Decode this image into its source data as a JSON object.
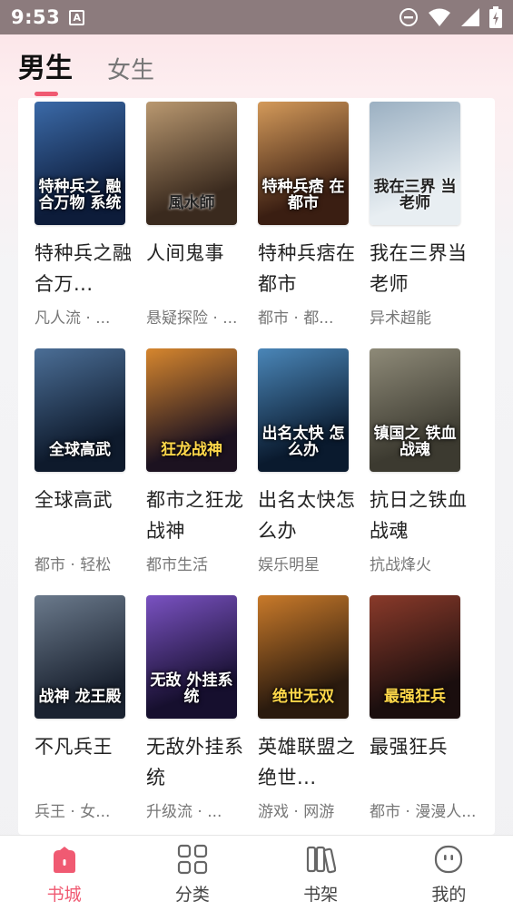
{
  "status_bar": {
    "time": "9:53",
    "notification": "A"
  },
  "tabs": [
    {
      "label": "男生",
      "active": true
    },
    {
      "label": "女生",
      "active": false
    }
  ],
  "books": [
    {
      "title": "特种兵之融合万...",
      "tags": "凡人流 · ...",
      "cover_text": "特种兵之 融合万物 系统",
      "cover_colors": [
        "#0d1c3a",
        "#3b6aa8"
      ],
      "cover_style": ""
    },
    {
      "title": "人间鬼事",
      "tags": "悬疑探险 · ...",
      "cover_text": "風水師",
      "cover_colors": [
        "#3a2a1e",
        "#b99870"
      ],
      "cover_style": "dark"
    },
    {
      "title": "特种兵痞在都市",
      "tags": "都市 · 都...",
      "cover_text": "特种兵痞 在都市",
      "cover_colors": [
        "#3a1e12",
        "#d49a5a"
      ],
      "cover_style": ""
    },
    {
      "title": "我在三界当老师",
      "tags": "异术超能",
      "cover_text": "我在三界 当老师",
      "cover_colors": [
        "#e8eef2",
        "#9bb0c2"
      ],
      "cover_style": "dark"
    },
    {
      "title": "全球高武",
      "tags": "都市 · 轻松",
      "cover_text": "全球高武",
      "cover_colors": [
        "#0e1a2c",
        "#4b6e96"
      ],
      "cover_style": ""
    },
    {
      "title": "都市之狂龙战神",
      "tags": "都市生活",
      "cover_text": "狂龙战神",
      "cover_colors": [
        "#1c1220",
        "#d6862e"
      ],
      "cover_style": "gold"
    },
    {
      "title": "出名太快怎么办",
      "tags": "娱乐明星",
      "cover_text": "出名太快 怎么办",
      "cover_colors": [
        "#0a1a2e",
        "#4a86b8"
      ],
      "cover_style": ""
    },
    {
      "title": "抗日之铁血战魂",
      "tags": "抗战烽火",
      "cover_text": "镇国之 铁血战魂",
      "cover_colors": [
        "#3c3a30",
        "#8e8a78"
      ],
      "cover_style": ""
    },
    {
      "title": "不凡兵王",
      "tags": "兵王 · 女...",
      "cover_text": "战神 龙王殿",
      "cover_colors": [
        "#1a2230",
        "#6b7a8c"
      ],
      "cover_style": ""
    },
    {
      "title": "无敌外挂系统",
      "tags": "升级流 · ...",
      "cover_text": "无敌 外挂系统",
      "cover_colors": [
        "#160f2e",
        "#7a52c2"
      ],
      "cover_style": ""
    },
    {
      "title": "英雄联盟之绝世...",
      "tags": "游戏 · 网游",
      "cover_text": "绝世无双",
      "cover_colors": [
        "#2a1a0e",
        "#c97a2a"
      ],
      "cover_style": "gold"
    },
    {
      "title": "最强狂兵",
      "tags": "都市 · 漫漫人...",
      "cover_text": "最强狂兵",
      "cover_colors": [
        "#1a0e0e",
        "#8a3a2a"
      ],
      "cover_style": "gold"
    }
  ],
  "bottom_nav": [
    {
      "label": "书城",
      "icon": "bookstore-icon",
      "active": true
    },
    {
      "label": "分类",
      "icon": "category-grid-icon",
      "active": false
    },
    {
      "label": "书架",
      "icon": "bookshelf-icon",
      "active": false
    },
    {
      "label": "我的",
      "icon": "profile-face-icon",
      "active": false
    }
  ],
  "colors": {
    "accent": "#f05a72",
    "status_bar": "#8c7b7d"
  }
}
